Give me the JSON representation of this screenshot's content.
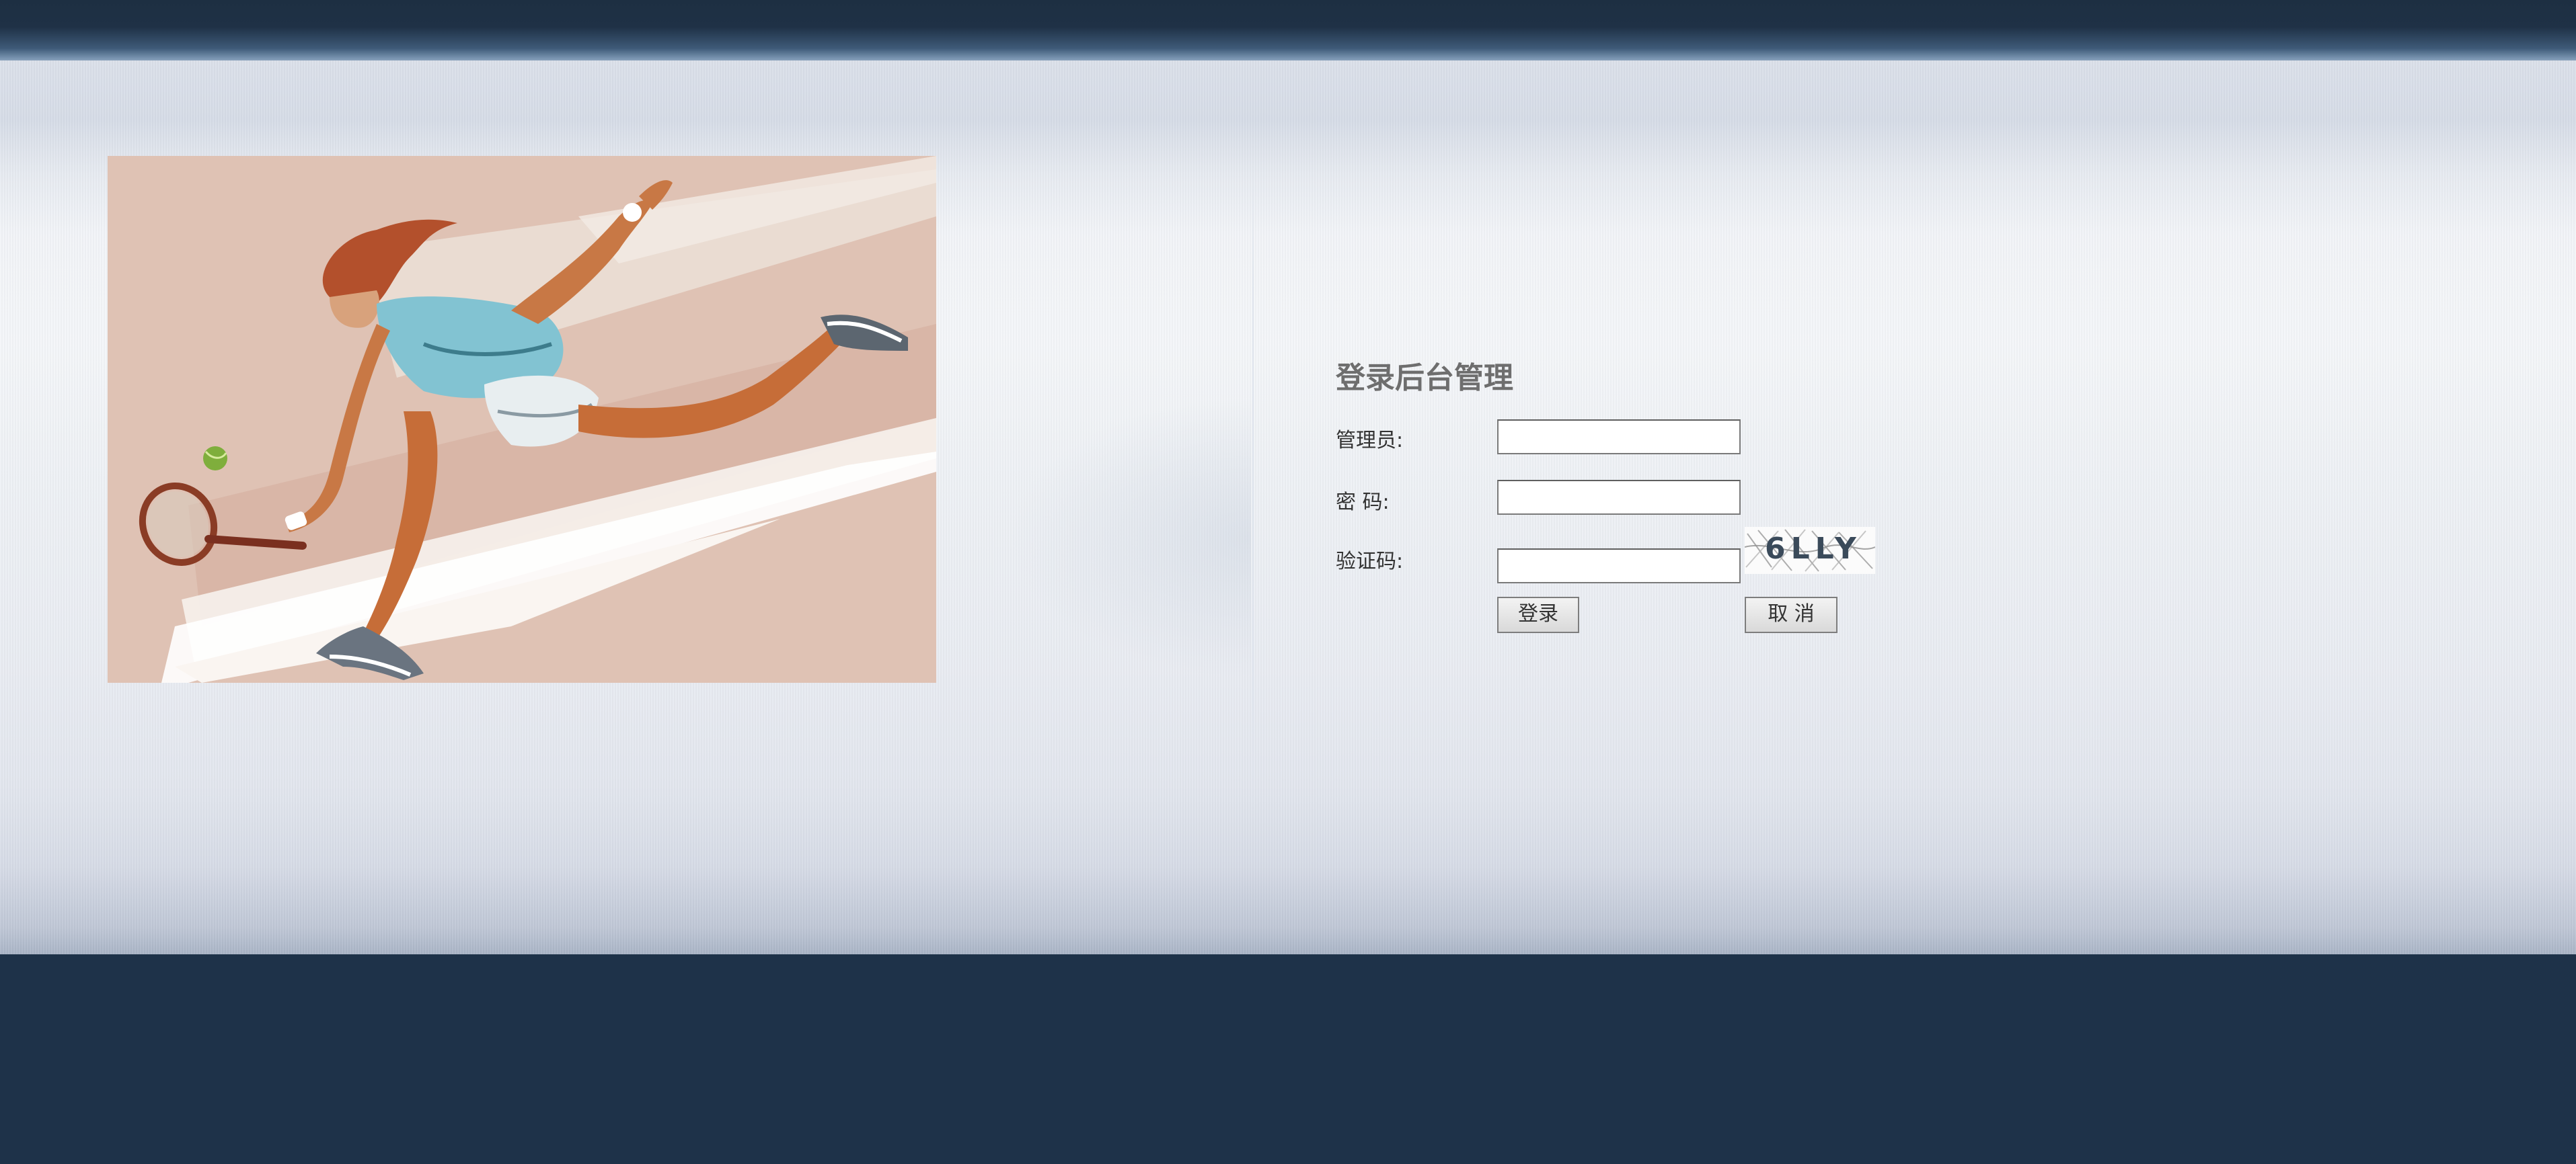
{
  "login": {
    "title": "登录后台管理",
    "admin_label": "管理员:",
    "password_label": "密 码:",
    "captcha_label": "验证码:",
    "admin_value": "",
    "password_value": "",
    "captcha_value": "",
    "captcha_text": "6LLY",
    "login_button": "登录",
    "cancel_button": "取 消"
  },
  "illustration": {
    "subject": "tennis-player-illustration"
  },
  "colors": {
    "header_bar": "#1d2f42",
    "footer": "#1e3249",
    "panel_light": "#f3f5f8",
    "title_text": "#6e6e6e",
    "illustration_bg": "#dfc2b4"
  }
}
